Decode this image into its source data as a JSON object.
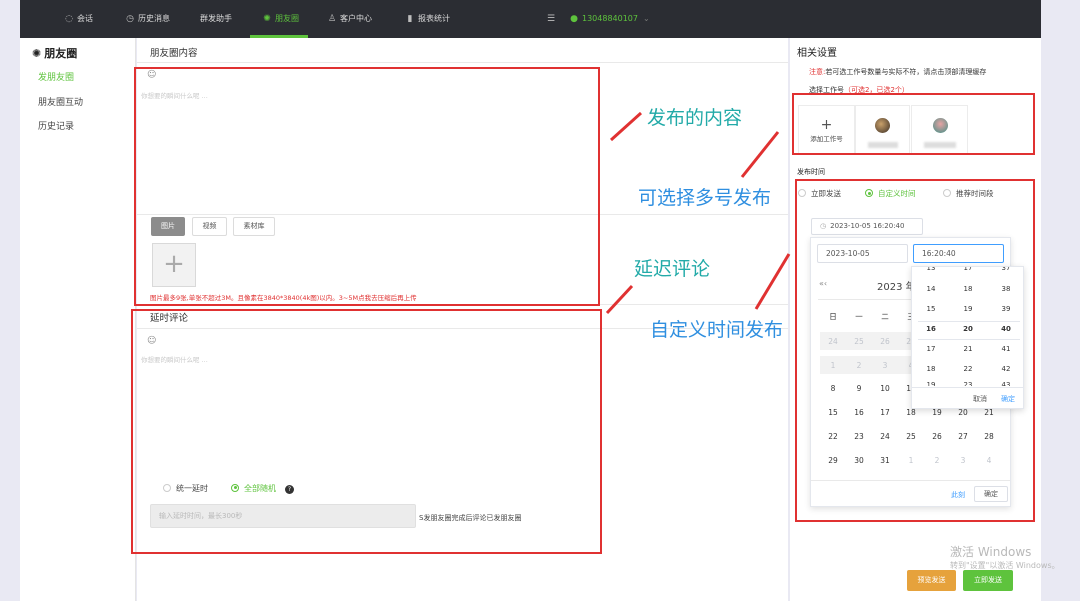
{
  "topnav": {
    "items": [
      {
        "label": "会话",
        "icon": "chat-icon"
      },
      {
        "label": "历史消息",
        "icon": "clock-icon"
      },
      {
        "label": "群发助手",
        "icon": ""
      },
      {
        "label": "朋友圈",
        "icon": "moments-icon"
      },
      {
        "label": "客户中心",
        "icon": "user-icon"
      },
      {
        "label": "报表统计",
        "icon": "bar-chart-icon"
      }
    ],
    "active_index": 3,
    "phone": "13048840107",
    "accent": "#5ec33d",
    "bg": "#2b2d33"
  },
  "sidebar": {
    "title": "朋友圈",
    "items": [
      "发朋友圈",
      "朋友圈互动",
      "历史记录"
    ],
    "active_index": 0
  },
  "content": {
    "title": "朋友圈内容",
    "placeholder": "你想要的瞬间什么呢 ...",
    "media_tabs": [
      "图片",
      "视频",
      "素材库"
    ],
    "upload_note": "图片最多9张,单张不超过3M。且像素在3840*3840(4k图)以内。3~5M点我去压缩后再上传"
  },
  "comment": {
    "title": "延时评论",
    "placeholder": "你想要的瞬间什么呢 ...",
    "options": [
      "统一延时",
      "全部随机"
    ],
    "selected_option": 1,
    "delay_input_placeholder": "输入延时时间，最长300秒",
    "delay_suffix": "S发朋友圈完成后评论已发朋友圈"
  },
  "annotations": {
    "content": "发布的内容",
    "multi": "可选择多号发布",
    "delay": "延迟评论",
    "custom_time": "自定义时间发布"
  },
  "settings": {
    "title": "相关设置",
    "notice_label": "注意:",
    "notice_text": "若可选工作号数量与实际不符，请点击顶部清理缓存",
    "select_label": "选择工作号",
    "select_hint": "（可选2，已选2个）",
    "add_account": "添加工作号",
    "publish_time_label": "发布时间",
    "time_options": [
      "立即发送",
      "自定义时间",
      "推荐时间段"
    ],
    "time_selected": 1,
    "datetime_value": "2023-10-05 16:20:40"
  },
  "picker": {
    "date_value": "2023-10-05",
    "time_value": "16:20:40",
    "nav_prev": "«‹",
    "header": "2023 年",
    "weekdays": [
      "日",
      "一",
      "二",
      "三"
    ],
    "weeks": [
      [
        "24",
        "25",
        "26",
        "27",
        "",
        "",
        ""
      ],
      [
        "1",
        "2",
        "3",
        "4",
        "",
        "",
        ""
      ],
      [
        "8",
        "9",
        "10",
        "11",
        "",
        "",
        ""
      ],
      [
        "15",
        "16",
        "17",
        "18",
        "19",
        "20",
        "21"
      ],
      [
        "22",
        "23",
        "24",
        "25",
        "26",
        "27",
        "28"
      ],
      [
        "29",
        "30",
        "31",
        "1",
        "2",
        "3",
        "4"
      ]
    ],
    "now_label": "此刻",
    "confirm_label": "确定"
  },
  "time_panel": {
    "top_partial": [
      "13",
      "17",
      "37"
    ],
    "rows": [
      [
        "14",
        "18",
        "38"
      ],
      [
        "15",
        "19",
        "39"
      ],
      [
        "16",
        "20",
        "40"
      ],
      [
        "17",
        "21",
        "41"
      ],
      [
        "18",
        "22",
        "42"
      ]
    ],
    "bottom_partial": [
      "19",
      "23",
      "43"
    ],
    "selected_row": 2,
    "cancel_label": "取消",
    "ok_label": "确定"
  },
  "footer": {
    "watermark_title": "激活 Windows",
    "watermark_sub": "转到\"设置\"以激活 Windows。",
    "preview_btn": "预览发送",
    "send_btn": "立即发送"
  }
}
